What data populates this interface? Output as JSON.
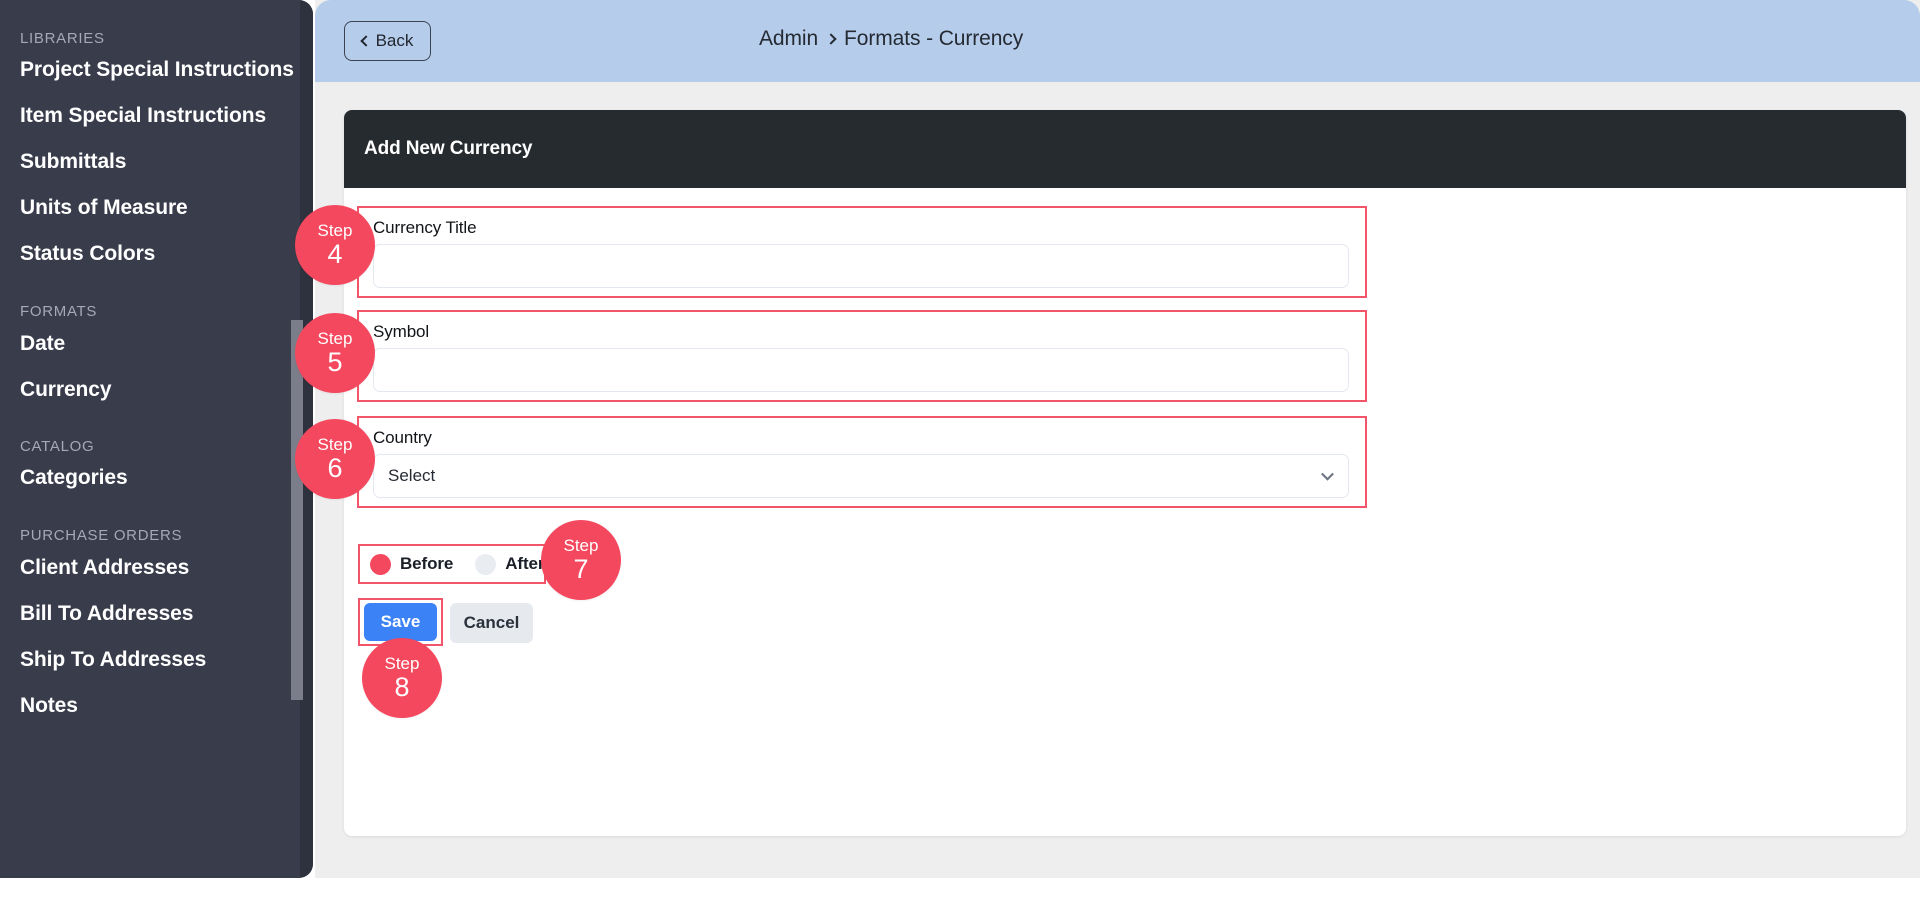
{
  "sidebar": {
    "sections": [
      {
        "title": "LIBRARIES",
        "items": [
          {
            "label": "Project Special Instructions"
          },
          {
            "label": "Item Special Instructions"
          },
          {
            "label": "Submittals"
          },
          {
            "label": "Units of Measure"
          },
          {
            "label": "Status Colors"
          }
        ]
      },
      {
        "title": "FORMATS",
        "items": [
          {
            "label": "Date"
          },
          {
            "label": "Currency"
          }
        ]
      },
      {
        "title": "CATALOG",
        "items": [
          {
            "label": "Categories"
          }
        ]
      },
      {
        "title": "PURCHASE ORDERS",
        "items": [
          {
            "label": "Client Addresses"
          },
          {
            "label": "Bill To Addresses"
          },
          {
            "label": "Ship To Addresses"
          },
          {
            "label": "Notes"
          }
        ]
      }
    ]
  },
  "topbar": {
    "back_label": "Back",
    "breadcrumb": {
      "root": "Admin",
      "current": "Formats - Currency"
    },
    "close_icon": "close-circle-icon"
  },
  "card": {
    "title": "Add New Currency",
    "fields": {
      "currency_title": {
        "label": "Currency Title",
        "value": "",
        "placeholder": ""
      },
      "symbol": {
        "label": "Symbol",
        "value": "",
        "placeholder": ""
      },
      "country": {
        "label": "Country",
        "selected": "Select",
        "chevron_icon": "chevron-down-icon"
      }
    },
    "symbol_position": {
      "options": [
        {
          "label": "Before",
          "selected": true
        },
        {
          "label": "After",
          "selected": false
        }
      ]
    },
    "actions": {
      "save_label": "Save",
      "cancel_label": "Cancel"
    }
  },
  "steps": [
    {
      "word": "Step",
      "num": "4"
    },
    {
      "word": "Step",
      "num": "5"
    },
    {
      "word": "Step",
      "num": "6"
    },
    {
      "word": "Step",
      "num": "7"
    },
    {
      "word": "Step",
      "num": "8"
    }
  ],
  "colors": {
    "accent_red": "#f4485e",
    "sidebar_bg": "#393c4b",
    "topbar_bg": "#b5cdeb",
    "card_header_bg": "#252b2e",
    "save_blue": "#3b82f6"
  }
}
